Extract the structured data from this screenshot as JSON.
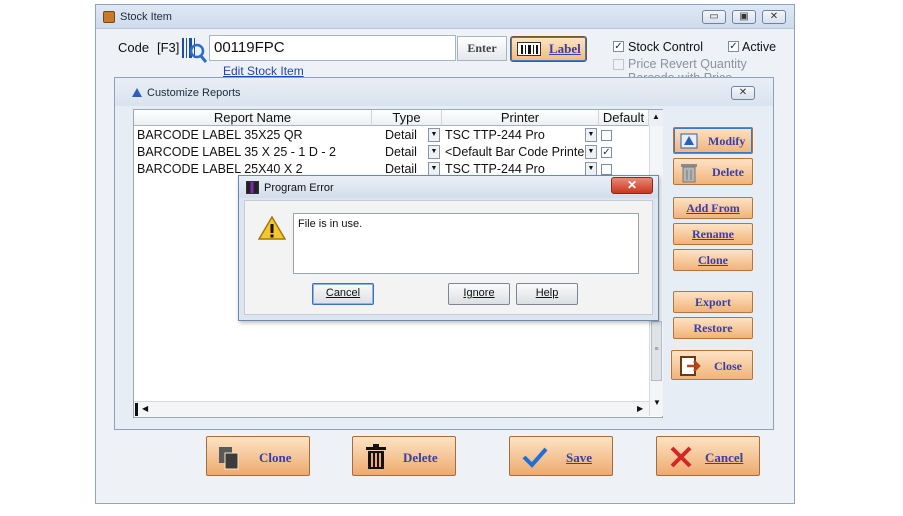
{
  "main_window": {
    "title": "Stock Item",
    "code_label": "Code",
    "code_shortcut": "[F3]",
    "code_value": "00119FPC",
    "enter_button": "Enter",
    "label_button": "Label",
    "edit_link": "Edit Stock Item",
    "stock_control": {
      "label": "Stock Control",
      "checked": true
    },
    "active": {
      "label": "Active",
      "checked": true
    },
    "price_revert": {
      "label": "Price Revert Quantity",
      "checked": false
    },
    "barcode_with_price": {
      "label": "Barcode with Price"
    }
  },
  "customize": {
    "title": "Customize Reports",
    "columns": [
      "Report Name",
      "Type",
      "Printer",
      "Default"
    ],
    "rows": [
      {
        "name": "BARCODE LABEL 35X25 QR",
        "type": "Detail",
        "printer": "TSC TTP-244 Pro",
        "default": "☐"
      },
      {
        "name": "BARCODE LABEL 35 X 25 - 1 D - 2",
        "type": "Detail",
        "printer": "<Default Bar Code Printer>",
        "default": "✓"
      },
      {
        "name": "BARCODE LABEL 25X40 X 2",
        "type": "Detail",
        "printer": "TSC TTP-244 Pro",
        "default": "☐"
      }
    ],
    "buttons": {
      "modify": "Modify",
      "delete": "Delete",
      "add_from": "Add From",
      "rename": "Rename",
      "clone": "Clone",
      "export": "Export",
      "restore": "Restore",
      "close": "Close"
    }
  },
  "bottom_buttons": {
    "clone": "Clone",
    "delete": "Delete",
    "save": "Save",
    "cancel": "Cancel"
  },
  "error_dialog": {
    "title": "Program Error",
    "message": "File is in use.",
    "cancel": "Cancel",
    "ignore": "Ignore",
    "help": "Help"
  },
  "colors": {
    "accent_orange": "#f1b37a",
    "link_blue": "#1f43b8",
    "error_close": "#d9452b"
  }
}
